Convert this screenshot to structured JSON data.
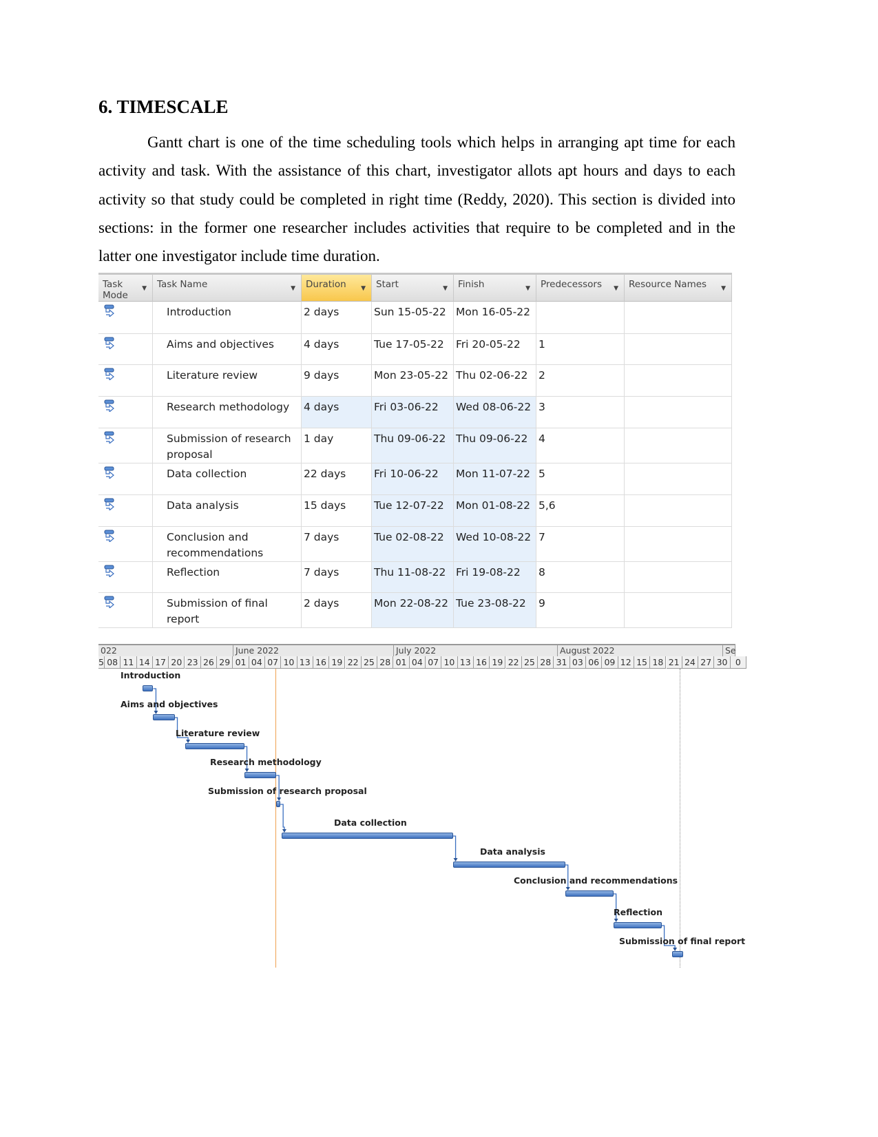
{
  "heading": "6. TIMESCALE",
  "paragraph": "Gantt chart is one of the time scheduling tools which helps in arranging apt time for each activity and task. With the assistance of this chart, investigator allots apt hours and days to each activity so that study could be completed in right time (Reddy, 2020). This section is divided into sections: in the former one researcher includes activities that require to be completed and in the latter one investigator include time duration.",
  "table": {
    "columns": [
      "Task Mode",
      "Task Name",
      "Duration",
      "Start",
      "Finish",
      "Predecessors",
      "Resource Names"
    ],
    "selected_column": "Duration",
    "task_mode_icon": "auto-scheduled-task-icon",
    "rows": [
      {
        "name": "Introduction",
        "duration": "2 days",
        "start": "Sun 15-05-22",
        "finish": "Mon 16-05-22",
        "pred": "",
        "res": ""
      },
      {
        "name": "Aims and objectives",
        "duration": "4 days",
        "start": "Tue 17-05-22",
        "finish": "Fri 20-05-22",
        "pred": "1",
        "res": ""
      },
      {
        "name": "Literature review",
        "duration": "9 days",
        "start": "Mon 23-05-22",
        "finish": "Thu 02-06-22",
        "pred": "2",
        "res": ""
      },
      {
        "name": "Research methodology",
        "duration": "4 days",
        "start": "Fri 03-06-22",
        "finish": "Wed 08-06-22",
        "pred": "3",
        "res": ""
      },
      {
        "name": "Submission of research proposal",
        "duration": "1 day",
        "start": "Thu 09-06-22",
        "finish": "Thu 09-06-22",
        "pred": "4",
        "res": ""
      },
      {
        "name": "Data collection",
        "duration": "22 days",
        "start": "Fri 10-06-22",
        "finish": "Mon 11-07-22",
        "pred": "5",
        "res": ""
      },
      {
        "name": "Data analysis",
        "duration": "15 days",
        "start": "Tue 12-07-22",
        "finish": "Mon 01-08-22",
        "pred": "5,6",
        "res": ""
      },
      {
        "name": "Conclusion and recommendations",
        "duration": "7 days",
        "start": "Tue 02-08-22",
        "finish": "Wed 10-08-22",
        "pred": "7",
        "res": ""
      },
      {
        "name": "Reflection",
        "duration": "7 days",
        "start": "Thu 11-08-22",
        "finish": "Fri 19-08-22",
        "pred": "8",
        "res": ""
      },
      {
        "name": "Submission of final report",
        "duration": "2 days",
        "start": "Mon 22-08-22",
        "finish": "Tue 23-08-22",
        "pred": "9",
        "res": ""
      }
    ]
  },
  "chart_data": {
    "type": "gantt",
    "months": [
      "022",
      "June 2022",
      "July 2022",
      "August 2022",
      "Se"
    ],
    "day_ticks": [
      "5",
      "08",
      "11",
      "14",
      "17",
      "20",
      "23",
      "26",
      "29",
      "01",
      "04",
      "07",
      "10",
      "13",
      "16",
      "19",
      "22",
      "25",
      "28",
      "01",
      "04",
      "07",
      "10",
      "13",
      "16",
      "19",
      "22",
      "25",
      "28",
      "31",
      "03",
      "06",
      "09",
      "12",
      "15",
      "18",
      "21",
      "24",
      "27",
      "30",
      "0"
    ],
    "tasks": [
      {
        "label": "Introduction",
        "start": "2022-05-15",
        "finish": "2022-05-16"
      },
      {
        "label": "Aims and objectives",
        "start": "2022-05-17",
        "finish": "2022-05-20"
      },
      {
        "label": "Literature review",
        "start": "2022-05-23",
        "finish": "2022-06-02"
      },
      {
        "label": "Research methodology",
        "start": "2022-06-03",
        "finish": "2022-06-08"
      },
      {
        "label": "Submission of research proposal",
        "start": "2022-06-09",
        "finish": "2022-06-09"
      },
      {
        "label": "Data collection",
        "start": "2022-06-10",
        "finish": "2022-07-11"
      },
      {
        "label": "Data analysis",
        "start": "2022-07-12",
        "finish": "2022-08-01"
      },
      {
        "label": "Conclusion and recommendations",
        "start": "2022-08-02",
        "finish": "2022-08-10"
      },
      {
        "label": "Reflection",
        "start": "2022-08-11",
        "finish": "2022-08-19"
      },
      {
        "label": "Submission of final report",
        "start": "2022-08-22",
        "finish": "2022-08-23"
      }
    ],
    "colors": {
      "bar": "#4a7cc7",
      "today_line": "#f0a050"
    }
  }
}
